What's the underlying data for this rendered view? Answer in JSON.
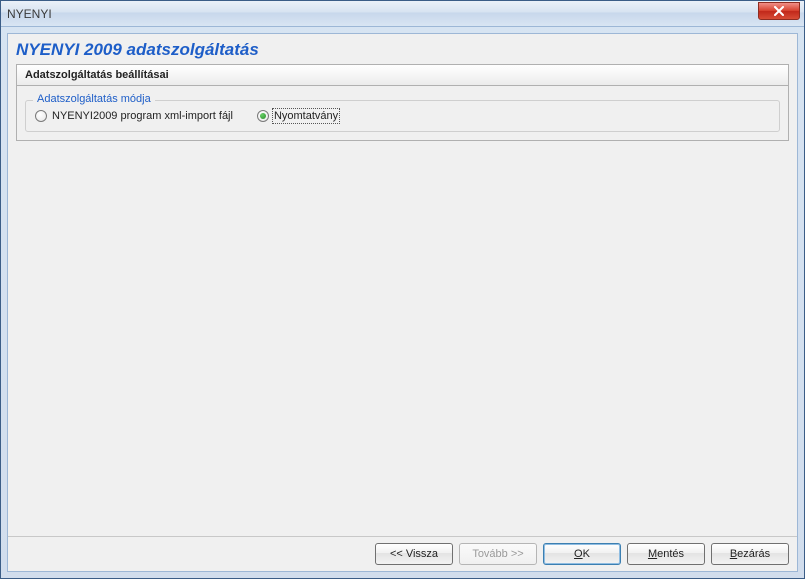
{
  "window": {
    "title": "NYENYI"
  },
  "page": {
    "title": "NYENYI 2009 adatszolgáltatás",
    "section_heading": "Adatszolgáltatás beállításai",
    "group_legend": "Adatszolgáltatás módja"
  },
  "radios": {
    "xml_import": {
      "label": "NYENYI2009 program xml-import fájl",
      "checked": false
    },
    "nyomtatvany": {
      "label": "Nyomtatvány",
      "checked": true
    }
  },
  "buttons": {
    "back": {
      "label": "<< Vissza",
      "enabled": true
    },
    "next": {
      "label": "Tovább >>",
      "enabled": false
    },
    "ok": {
      "prefix_u": "O",
      "rest": "K",
      "enabled": true,
      "default": true
    },
    "save": {
      "prefix_u": "M",
      "rest": "entés",
      "enabled": true
    },
    "close": {
      "prefix_u": "B",
      "rest": "ezárás",
      "enabled": true
    }
  }
}
